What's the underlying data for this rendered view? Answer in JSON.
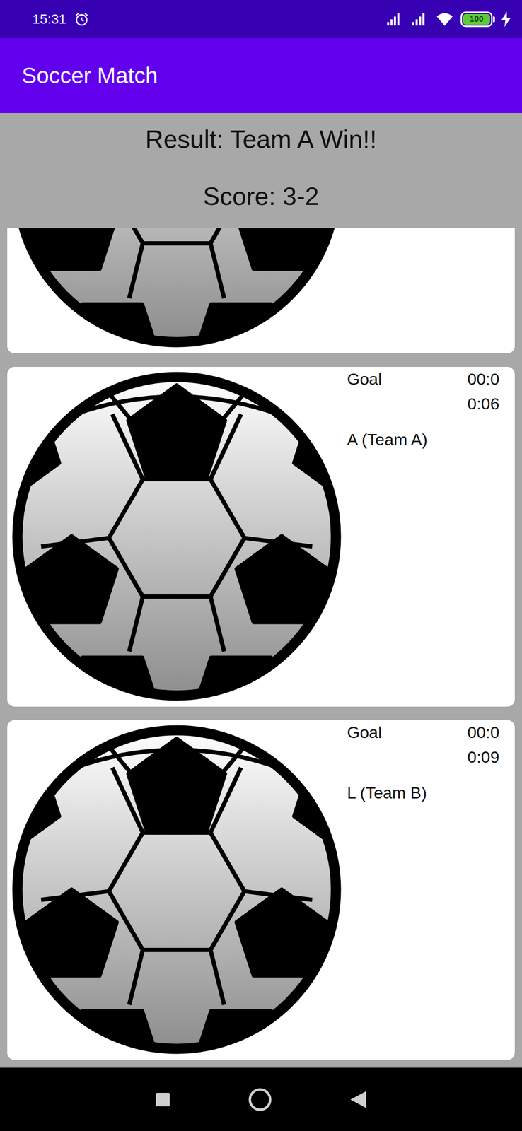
{
  "status_bar": {
    "time": "15:31",
    "battery": "100",
    "battery_level": 1,
    "charging": true
  },
  "app_bar": {
    "title": "Soccer Match"
  },
  "result": {
    "title": "Result: Team A Win!!",
    "score": "Score: 3-2"
  },
  "events": [
    {
      "cut_off": true
    },
    {
      "cut_off": false,
      "type": "Goal",
      "time": "00:00:06",
      "player": "A (Team A)"
    },
    {
      "cut_off": false,
      "type": "Goal",
      "time": "00:00:09",
      "player": "L (Team B)"
    }
  ]
}
